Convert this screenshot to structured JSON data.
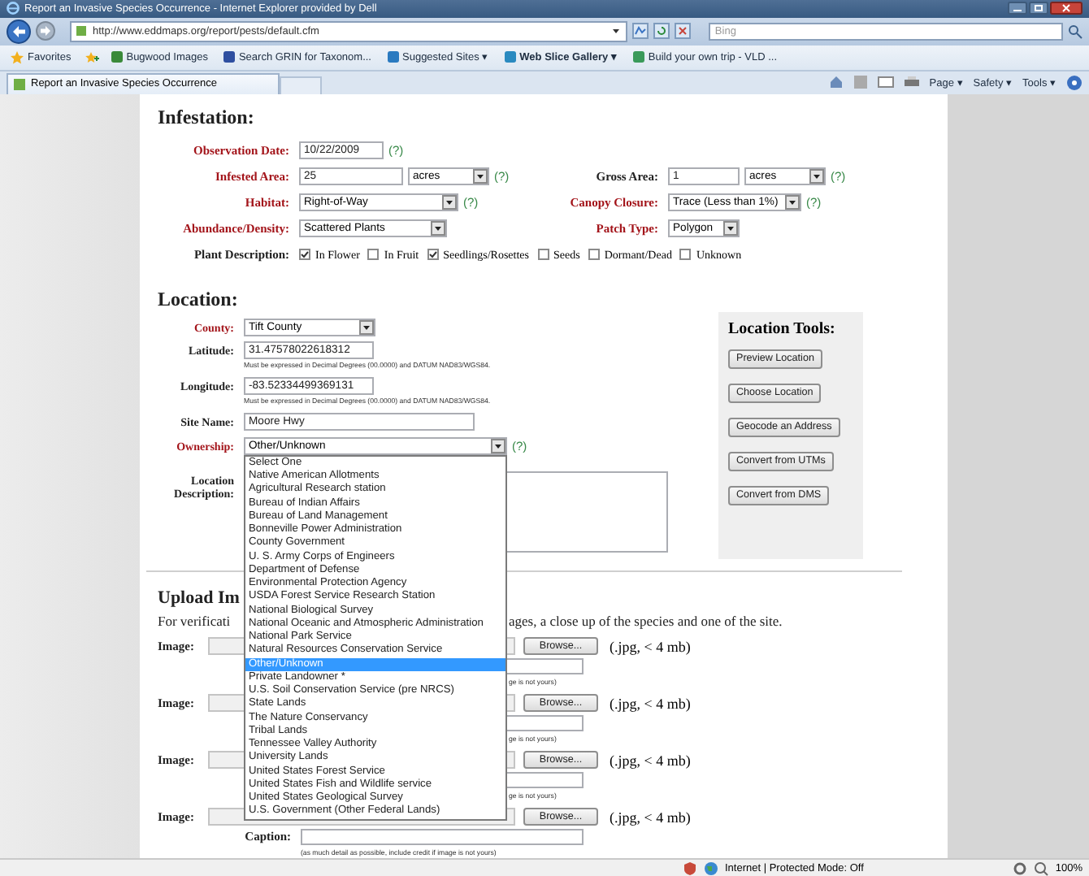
{
  "window": {
    "title": "Report an Invasive Species Occurrence - Internet Explorer provided by Dell"
  },
  "address_bar": {
    "url": "http://www.eddmaps.org/report/pests/default.cfm",
    "search_placeholder": "Bing"
  },
  "favorites_bar": {
    "favorites": "Favorites",
    "links": [
      {
        "label": "Bugwood Images",
        "bold": false
      },
      {
        "label": "Search GRIN for Taxonom...",
        "bold": false
      },
      {
        "label": "Suggested Sites ▾",
        "bold": false
      },
      {
        "label": "Web Slice Gallery ▾",
        "bold": true
      },
      {
        "label": "Build your own trip - VLD ...",
        "bold": false
      }
    ]
  },
  "tab": {
    "label": "Report an Invasive Species Occurrence"
  },
  "command_bar": [
    "Page ▾",
    "Safety ▾",
    "Tools ▾"
  ],
  "infestation": {
    "heading": "Infestation:",
    "rows": [
      [
        {
          "label": "Observation Date:",
          "required": true,
          "kind": "text",
          "value": "10/22/2009",
          "help": "(?)"
        }
      ],
      [
        {
          "label": "Infested Area:",
          "required": true,
          "kind": "text",
          "value": "25",
          "unit": "acres",
          "help": "(?)"
        },
        {
          "label": "Gross Area:",
          "required": false,
          "kind": "text",
          "value": "1",
          "unit": "acres",
          "help": "(?)"
        }
      ],
      [
        {
          "label": "Habitat:",
          "required": true,
          "kind": "select",
          "value": "Right-of-Way",
          "help": "(?)"
        },
        {
          "label": "Canopy Closure:",
          "required": true,
          "kind": "select",
          "value": "Trace (Less than 1%)",
          "help": "(?)"
        }
      ],
      [
        {
          "label": "Abundance/Density:",
          "required": true,
          "kind": "select",
          "value": "Scattered Plants"
        },
        {
          "label": "Patch Type:",
          "required": true,
          "kind": "select",
          "value": "Polygon"
        }
      ]
    ],
    "plant_description": {
      "label": "Plant Description:",
      "options": [
        {
          "label": "In Flower",
          "checked": true
        },
        {
          "label": "In Fruit",
          "checked": false
        },
        {
          "label": "Seedlings/Rosettes",
          "checked": true
        },
        {
          "label": "Seeds",
          "checked": false
        },
        {
          "label": "Dormant/Dead",
          "checked": false
        },
        {
          "label": "Unknown",
          "checked": false
        }
      ]
    }
  },
  "location": {
    "heading": "Location:",
    "fields": [
      {
        "label": "County:",
        "required": true,
        "kind": "select",
        "value": "Tift County"
      },
      {
        "label": "Latitude:",
        "required": false,
        "kind": "text",
        "value": "31.47578022618312",
        "hint": "Must be expressed in Decimal Degrees (00.0000) and DATUM NAD83/WGS84."
      },
      {
        "label": "Longitude:",
        "required": false,
        "kind": "text",
        "value": "-83.52334499369131",
        "hint": "Must be expressed in Decimal Degrees (00.0000) and DATUM NAD83/WGS84."
      },
      {
        "label": "Site Name:",
        "required": false,
        "kind": "text",
        "value": "Moore Hwy"
      },
      {
        "label": "Ownership:",
        "required": true,
        "kind": "select",
        "value": "Other/Unknown",
        "help": "(?)",
        "expanded": true,
        "options": [
          {
            "label": "Select One",
            "selected": false
          },
          {
            "label": "Native American Allotments",
            "selected": false
          },
          {
            "label": "Agricultural Research station",
            "selected": false
          },
          {
            "label": "Bureau of Indian Affairs",
            "selected": false
          },
          {
            "label": "Bureau of Land Management",
            "selected": false
          },
          {
            "label": "Bonneville Power Administration",
            "selected": false
          },
          {
            "label": "County Government",
            "selected": false
          },
          {
            "label": "U. S. Army Corps of Engineers",
            "selected": false
          },
          {
            "label": "Department of Defense",
            "selected": false
          },
          {
            "label": "Environmental Protection Agency",
            "selected": false
          },
          {
            "label": "USDA Forest Service Research Station",
            "selected": false
          },
          {
            "label": "National Biological Survey",
            "selected": false
          },
          {
            "label": "National Oceanic and Atmospheric Administration",
            "selected": false
          },
          {
            "label": "National Park Service",
            "selected": false
          },
          {
            "label": "Natural Resources Conservation Service",
            "selected": false
          },
          {
            "label": "Other/Unknown",
            "selected": true
          },
          {
            "label": "Private Landowner *",
            "selected": false
          },
          {
            "label": "U.S. Soil Conservation Service (pre NRCS)",
            "selected": false
          },
          {
            "label": "State Lands",
            "selected": false
          },
          {
            "label": "The Nature Conservancy",
            "selected": false
          },
          {
            "label": "Tribal Lands",
            "selected": false
          },
          {
            "label": "Tennessee Valley Authority",
            "selected": false
          },
          {
            "label": "University Lands",
            "selected": false
          },
          {
            "label": "United States Forest Service",
            "selected": false
          },
          {
            "label": "United States Fish and Wildlife service",
            "selected": false
          },
          {
            "label": "United States Geological Survey",
            "selected": false
          },
          {
            "label": "U.S. Government (Other Federal Lands)",
            "selected": false
          }
        ]
      },
      {
        "label": "Location Description:",
        "required": false,
        "kind": "textarea"
      }
    ]
  },
  "location_tools": {
    "heading": "Location Tools:",
    "buttons": [
      "Preview Location",
      "Choose Location",
      "Geocode an Address",
      "Convert from UTMs",
      "Convert from DMS"
    ]
  },
  "upload": {
    "heading": "Upload Im",
    "intro_start": "For verificati",
    "intro_end": "ages, a close up of the species and one of the site.",
    "images": [
      {
        "label": "Image:",
        "button": "Browse...",
        "limit": "(.jpg, < 4 mb)",
        "caption": {
          "hint": "ge is not yours)"
        }
      },
      {
        "label": "Image:",
        "button": "Browse...",
        "limit": "(.jpg, < 4 mb)",
        "caption": {
          "hint": "ge is not yours)"
        }
      },
      {
        "label": "Image:",
        "button": "Browse...",
        "limit": "(.jpg, < 4 mb)",
        "caption": {
          "hint": "ge is not yours)"
        }
      },
      {
        "label": "Image:",
        "button": "Browse...",
        "limit": "(.jpg, < 4 mb)",
        "caption": {
          "label": "Caption:",
          "hint": "(as much detail as possible, include credit if image is not yours)"
        }
      }
    ]
  },
  "status_bar": {
    "zone": "Internet | Protected Mode: Off",
    "zoom": "100%"
  }
}
